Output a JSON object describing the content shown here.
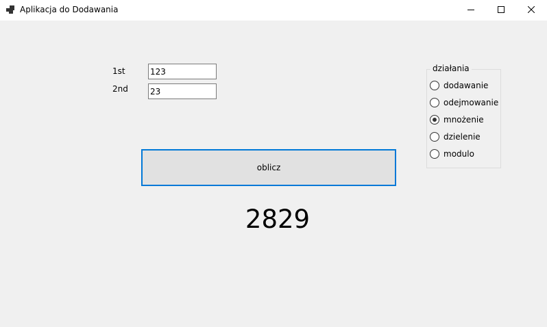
{
  "window": {
    "title": "Aplikacja do Dodawania",
    "icons": {
      "app": "app-icon",
      "minimize": "minimize-icon",
      "maximize": "maximize-icon",
      "close": "close-icon"
    }
  },
  "form": {
    "first_label": "1st",
    "second_label": "2nd",
    "first_value": "123",
    "second_value": "23",
    "calculate_label": "oblicz",
    "result": "2829"
  },
  "operations": {
    "title": "działania",
    "selected": "mnożenie",
    "options": [
      {
        "label": "dodawanie",
        "checked": false
      },
      {
        "label": "odejmowanie",
        "checked": false
      },
      {
        "label": "mnożenie",
        "checked": true
      },
      {
        "label": "dzielenie",
        "checked": false
      },
      {
        "label": "modulo",
        "checked": false
      }
    ]
  },
  "colors": {
    "accent": "#0078d7",
    "background": "#f0f0f0",
    "titlebar": "#ffffff"
  }
}
